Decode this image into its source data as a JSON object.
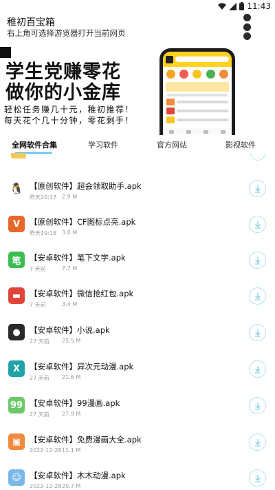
{
  "status_bar": {
    "time": "11:43",
    "icons": [
      "wifi-icon",
      "signal-icon",
      "battery-icon"
    ]
  },
  "header": {
    "title": "稚初百宝箱",
    "subtitle": "右上角可选择游览器打开当前网页",
    "menu_icon": "vertical-dots-icon"
  },
  "banner": {
    "headline_1": "学生党赚零花",
    "headline_2": "做你的小金库",
    "slogan_1": "轻松任务赚几十元，稚初推荐！",
    "slogan_2": "每天花个几十分钟，零花剩手！"
  },
  "tabs": [
    {
      "label": "全网软件合集",
      "active": true
    },
    {
      "label": "学习软件",
      "active": false
    },
    {
      "label": "官方网站",
      "active": false
    },
    {
      "label": "影视软件",
      "active": false
    }
  ],
  "items": [
    {
      "title": "【原创软件】超会领取助手.apk",
      "date": "昨天20:17",
      "size": "2.9 M",
      "icon": "qq-penguin-icon",
      "icon_color": "#ffffff",
      "glyph": "🐧"
    },
    {
      "title": "【原创软件】CF图标点亮.apk",
      "date": "昨天19:18",
      "size": "3.0 M",
      "icon": "cf-logo-icon",
      "icon_color": "#e8672a",
      "glyph": "V"
    },
    {
      "title": "【安卓软件】笔下文学.apk",
      "date": "7 天前",
      "size": "7.7 M",
      "icon": "pen-book-icon",
      "icon_color": "#3cbd52",
      "glyph": "笔"
    },
    {
      "title": "【安卓软件】微信抢红包.apk",
      "date": "7 天前",
      "size": "3.4 M",
      "icon": "red-packet-icon",
      "icon_color": "#e0453a",
      "glyph": "▬"
    },
    {
      "title": "【安卓软件】小说.apk",
      "date": "27 天前",
      "size": "25.5 M",
      "icon": "cat-paw-icon",
      "icon_color": "#2a2a2a",
      "glyph": "●"
    },
    {
      "title": "【安卓软件】异次元动漫.apk",
      "date": "27 天前",
      "size": "21.6 M",
      "icon": "x-anime-icon",
      "icon_color": "#1fa3a8",
      "glyph": "X"
    },
    {
      "title": "【安卓软件】99漫画.apk",
      "date": "27 天前",
      "size": "27.9 M",
      "icon": "99-comic-icon",
      "icon_color": "#6dc86a",
      "glyph": "99"
    },
    {
      "title": "【安卓软件】免费漫画大全.apk",
      "date": "2022-12-28",
      "size": "11.1 M",
      "icon": "comic-book-icon",
      "icon_color": "#f08a3c",
      "glyph": "▣"
    },
    {
      "title": "【安卓软件】木木动漫.apk",
      "date": "2022-12-28",
      "size": "20.7 M",
      "icon": "anime-girl-icon",
      "icon_color": "#7ab8e8",
      "glyph": "☺"
    }
  ]
}
